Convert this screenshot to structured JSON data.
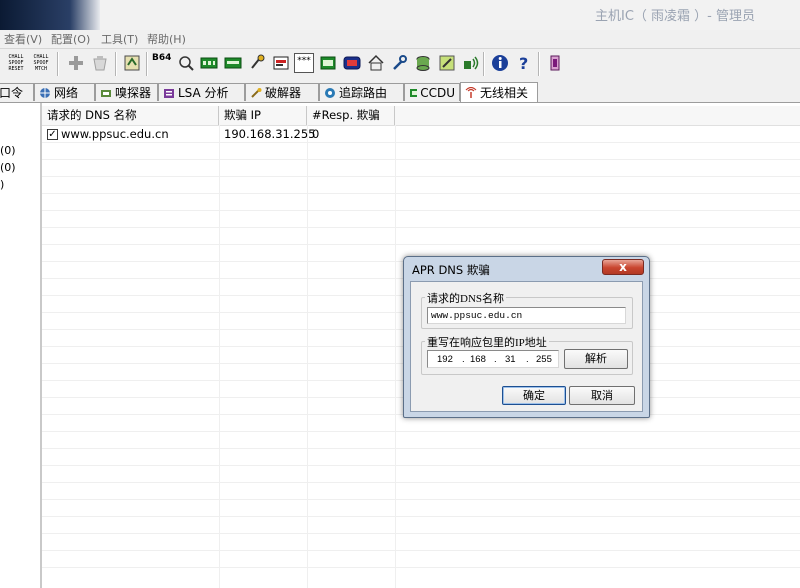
{
  "window": {
    "title": "主机IC（ 雨凌霜 ）- 管理员"
  },
  "menu": [
    "查看(V)",
    "配置(O)",
    "工具(T)",
    "帮助(H)"
  ],
  "toolbar": {
    "labels": {
      "challenge_spoof_reset": "CHALL SPOOF RESET",
      "challenge_spoof_match": "CHALL SPOOF MTCH",
      "base64": "B64",
      "dots": "***"
    }
  },
  "tabs": [
    {
      "label": "口令",
      "icon": "key-icon"
    },
    {
      "label": "网络",
      "icon": "network-icon"
    },
    {
      "label": "嗅探器",
      "icon": "sniffer-icon"
    },
    {
      "label": "LSA 分析",
      "icon": "lsa-icon"
    },
    {
      "label": "破解器",
      "icon": "cracker-icon"
    },
    {
      "label": "追踪路由",
      "icon": "traceroute-icon"
    },
    {
      "label": "CCDU",
      "icon": "ccdu-icon"
    },
    {
      "label": "无线相关",
      "icon": "wireless-icon"
    }
  ],
  "tree": [
    "(0)",
    "(0)",
    ")"
  ],
  "table": {
    "headers": [
      "请求的 DNS 名称",
      "欺骗 IP",
      "#Resp. 欺骗"
    ],
    "rows": [
      {
        "checked": true,
        "dns": "www.ppsuc.edu.cn",
        "ip": "190.168.31.255",
        "resp": "0"
      }
    ]
  },
  "dialog": {
    "title": "APR DNS 欺骗",
    "close_glyph": "x",
    "group1_label": "请求的DNS名称",
    "dns_value": "www.ppsuc.edu.cn",
    "group2_label": "重写在响应包里的IP地址",
    "ip_octets": [
      "192",
      "168",
      "31",
      "255"
    ],
    "resolve_label": "解析",
    "ok_label": "确定",
    "cancel_label": "取消"
  }
}
